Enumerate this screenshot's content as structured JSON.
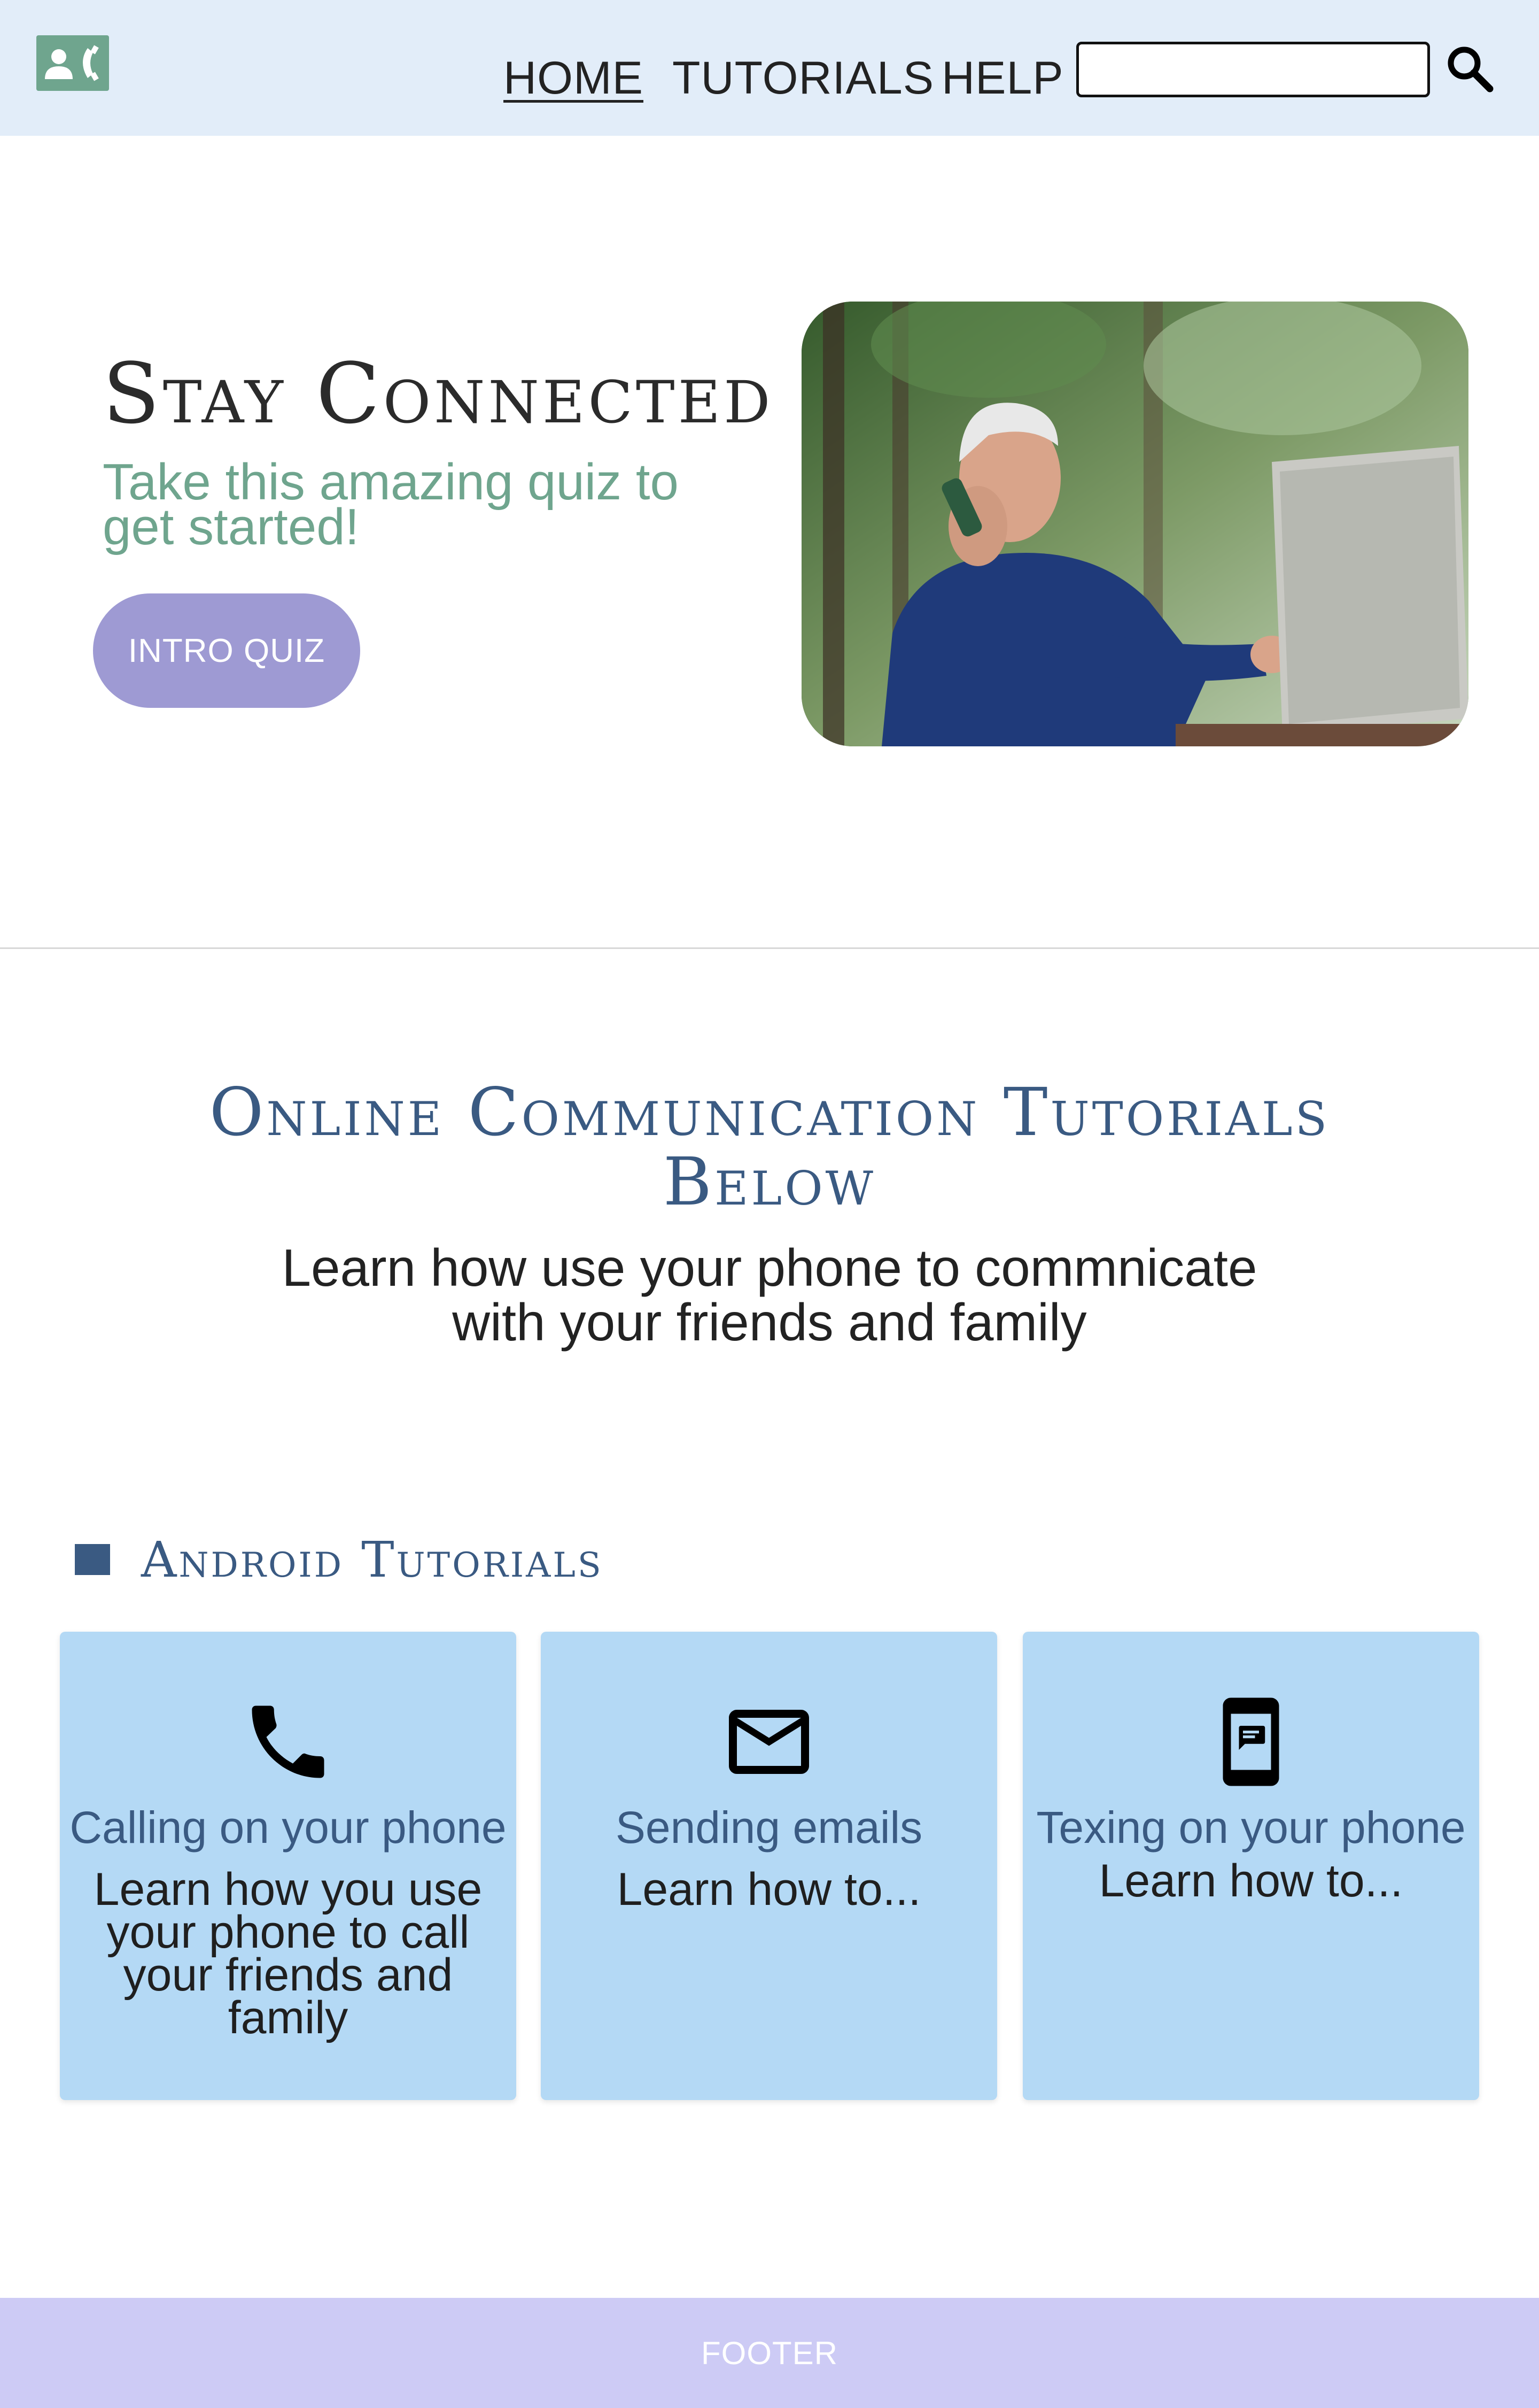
{
  "header": {
    "nav": [
      {
        "label": "HOME",
        "active": true
      },
      {
        "label": "TUTORIALS",
        "active": false
      },
      {
        "label": "HELP",
        "active": false
      }
    ],
    "search": {
      "value": "",
      "placeholder": ""
    }
  },
  "hero": {
    "title": "Stay Connected",
    "subtitle": "Take this amazing quiz to get started!",
    "button_label": "INTRO QUIZ",
    "photo_icon": "man-on-phone-with-laptop-photo"
  },
  "tutorials_intro": {
    "title": "Online Communication Tutorials Below",
    "subtitle": "Learn how use your phone to commnicate with your friends and family"
  },
  "android": {
    "heading": "Android Tutorials",
    "cards": [
      {
        "icon": "phone-icon",
        "title": "Calling on your phone",
        "description": "Learn how you use your phone to call your friends and family"
      },
      {
        "icon": "mail-icon",
        "title": "Sending emails",
        "description": "Learn how to..."
      },
      {
        "icon": "sms-icon",
        "title": "Texing on your phone",
        "description": "Learn how to..."
      }
    ]
  },
  "footer": {
    "label": "FOOTER"
  },
  "colors": {
    "header_bg": "#e2edf9",
    "accent_green": "#6fa58e",
    "button_purple": "#9e9ad3",
    "heading_blue": "#3a5a82",
    "card_bg": "#b4d9f5",
    "footer_bg": "#cdcbf5"
  }
}
